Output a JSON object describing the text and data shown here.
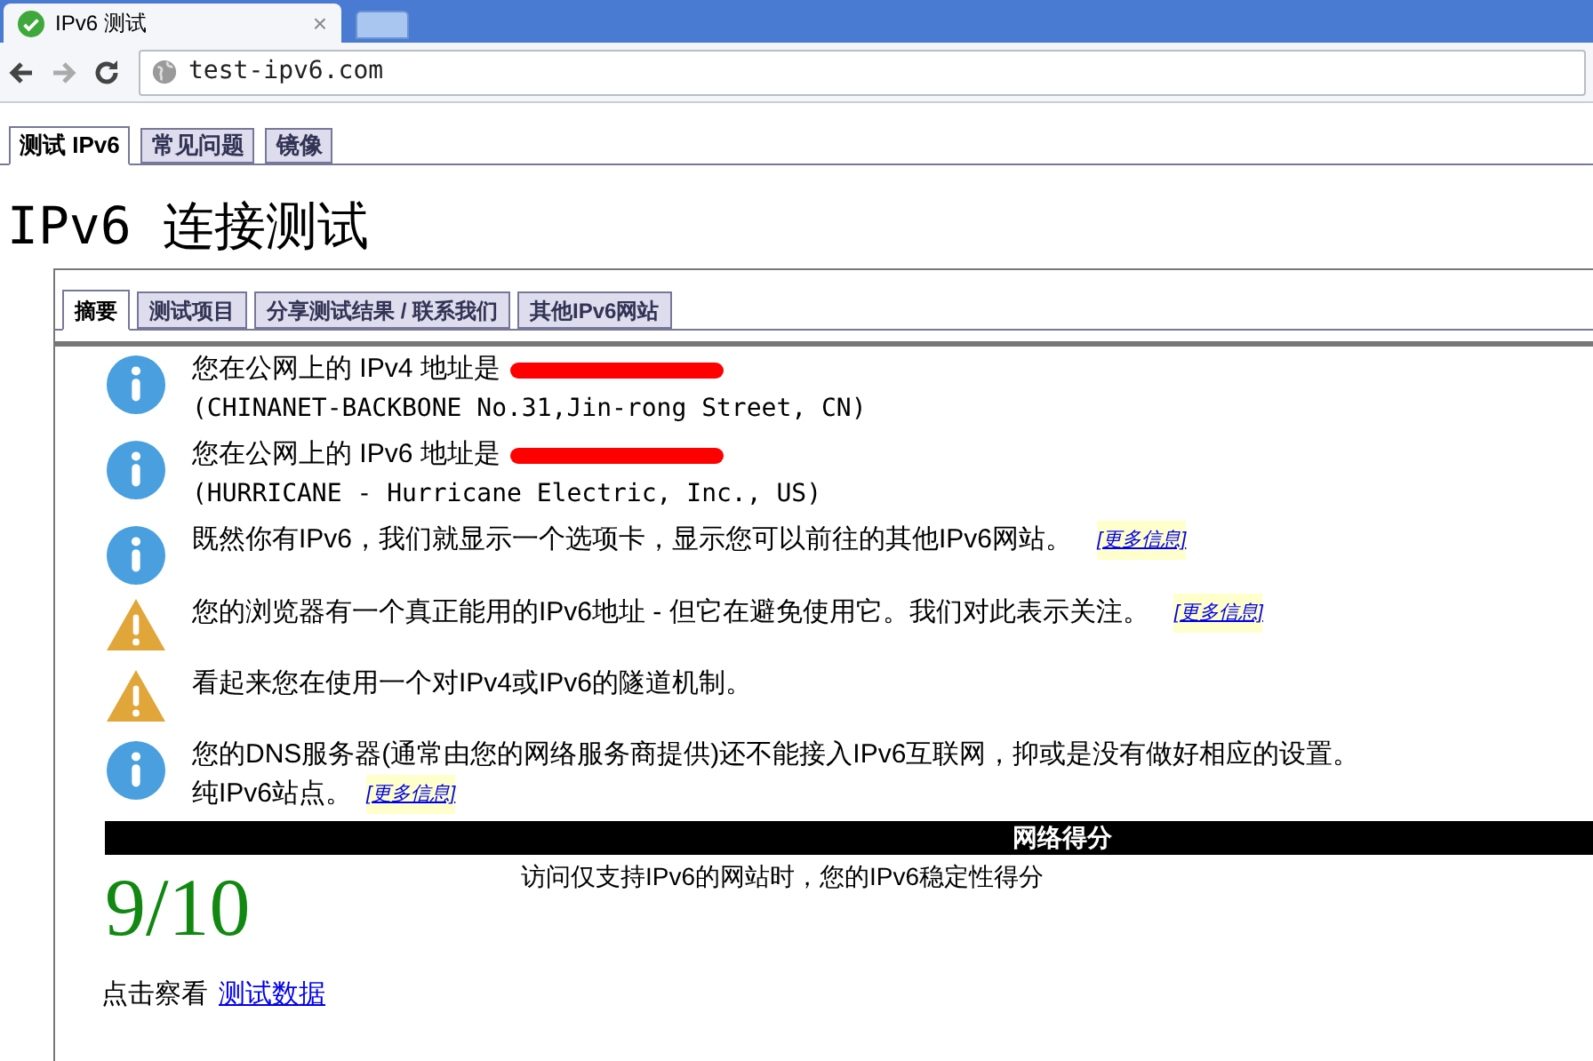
{
  "browser": {
    "tab": {
      "title": "IPv6 测试",
      "close": "×"
    },
    "address": "test-ipv6.com"
  },
  "site_tabs": [
    {
      "label": "测试 IPv6",
      "selected": true
    },
    {
      "label": "常见问题",
      "selected": false
    },
    {
      "label": "镜像",
      "selected": false
    }
  ],
  "heading": "IPv6 连接测试",
  "panel_tabs": [
    {
      "label": "摘要",
      "selected": true
    },
    {
      "label": "测试项目",
      "selected": false
    },
    {
      "label": "分享测试结果 / 联系我们",
      "selected": false
    },
    {
      "label": "其他IPv6网站",
      "selected": false
    }
  ],
  "messages": [
    {
      "kind": "info",
      "text": "您在公网上的 IPv4 地址是",
      "redacted": true,
      "detail": "(CHINANET-BACKBONE No.31,Jin-rong Street, CN)"
    },
    {
      "kind": "info",
      "text": "您在公网上的 IPv6 地址是",
      "redacted": true,
      "detail": "(HURRICANE - Hurricane Electric, Inc., US)"
    },
    {
      "kind": "info",
      "text": "既然你有IPv6，我们就显示一个选项卡，显示您可以前往的其他IPv6网站。",
      "link": "[更多信息]"
    },
    {
      "kind": "warning",
      "text": "您的浏览器有一个真正能用的IPv6地址 - 但它在避免使用它。我们对此表示关注。",
      "link": "[更多信息]"
    },
    {
      "kind": "warning",
      "text": "看起来您在使用一个对IPv4或IPv6的隧道机制。"
    },
    {
      "kind": "info",
      "text": "您的DNS服务器(通常由您的网络服务商提供)还不能接入IPv6互联网，抑或是没有做好相应的设置。",
      "detail": "纯IPv6站点。",
      "link": "[更多信息]"
    }
  ],
  "score": {
    "title": "网络得分",
    "value": "9/10",
    "description": "访问仅支持IPv6的网站时，您的IPv6稳定性得分"
  },
  "footer": {
    "text": "点击察看",
    "link": "测试数据"
  }
}
